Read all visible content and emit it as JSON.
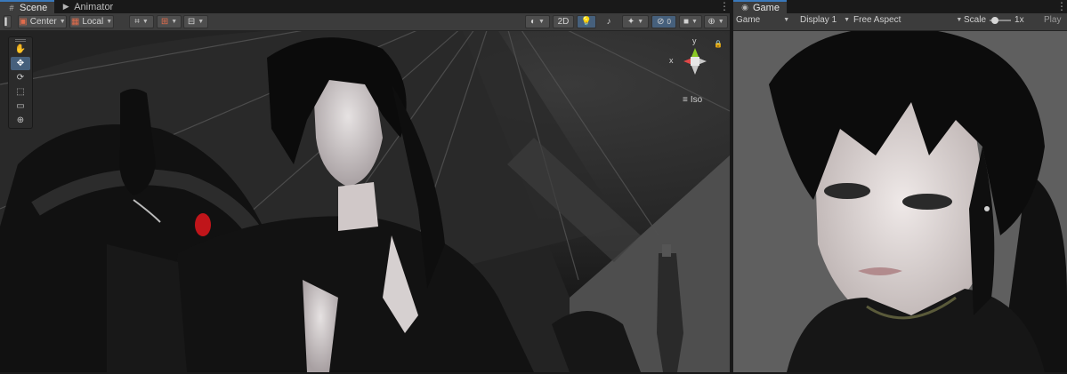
{
  "tabs_left": [
    {
      "label": "Scene",
      "icon": "grid-icon",
      "active": true
    },
    {
      "label": "Animator",
      "icon": "animator-icon",
      "active": false
    }
  ],
  "tabs_right": [
    {
      "label": "Game",
      "icon": "gamepad-icon",
      "active": true
    }
  ],
  "scene_toolbar": {
    "pivot_label": "Center",
    "space_label": "Local",
    "mode_2d_label": "2D"
  },
  "scene_tools": [
    {
      "name": "hand-tool",
      "icon": "✋"
    },
    {
      "name": "move-tool",
      "icon": "✥"
    },
    {
      "name": "rotate-tool",
      "icon": "⟳"
    },
    {
      "name": "scale-tool",
      "icon": "⬚"
    },
    {
      "name": "rect-tool",
      "icon": "▭"
    },
    {
      "name": "transform-tool",
      "icon": "⊕"
    }
  ],
  "gizmo": {
    "x_label": "x",
    "y_label": "y",
    "projection_label": "Iso"
  },
  "game_toolbar": {
    "view_label": "Game",
    "display_label": "Display 1",
    "aspect_label": "Free Aspect",
    "scale_label": "Scale",
    "scale_value": "1x",
    "play_label": "Play"
  },
  "colors": {
    "accent": "#3a79bb",
    "panel_bg": "#3c3c3c",
    "scene_bg": "#262626",
    "game_bg": "#5e5e5e"
  }
}
